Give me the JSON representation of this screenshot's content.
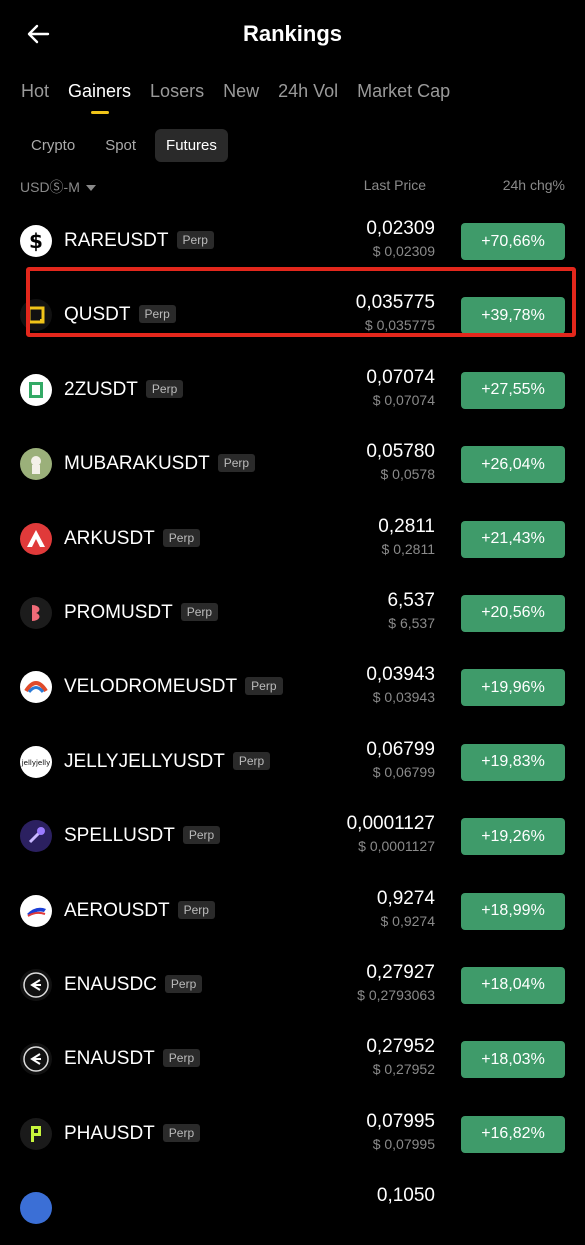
{
  "header": {
    "title": "Rankings"
  },
  "tabs": [
    "Hot",
    "Gainers",
    "Losers",
    "New",
    "24h Vol",
    "Market Cap"
  ],
  "active_tab": 1,
  "subtabs": [
    "Crypto",
    "Spot",
    "Futures"
  ],
  "active_subtab": 2,
  "columns": {
    "market": "USDⓈ-M",
    "last_price": "Last Price",
    "change": "24h chg%"
  },
  "colors": {
    "gain": "#3f9b6a",
    "accent": "#f0c419",
    "highlight": "#e3271c"
  },
  "rows": [
    {
      "symbol": "RAREUSDT",
      "tag": "Perp",
      "price": "0,02309",
      "usd": "$ 0,02309",
      "change": "+70,66%",
      "icon": "rare-icon"
    },
    {
      "symbol": "QUSDT",
      "tag": "Perp",
      "price": "0,035775",
      "usd": "$ 0,035775",
      "change": "+39,78%",
      "icon": "q-icon"
    },
    {
      "symbol": "2ZUSDT",
      "tag": "Perp",
      "price": "0,07074",
      "usd": "$ 0,07074",
      "change": "+27,55%",
      "icon": "2z-icon"
    },
    {
      "symbol": "MUBARAKUSDT",
      "tag": "Perp",
      "price": "0,05780",
      "usd": "$ 0,0578",
      "change": "+26,04%",
      "icon": "mubarak-icon"
    },
    {
      "symbol": "ARKUSDT",
      "tag": "Perp",
      "price": "0,2811",
      "usd": "$ 0,2811",
      "change": "+21,43%",
      "icon": "ark-icon"
    },
    {
      "symbol": "PROMUSDT",
      "tag": "Perp",
      "price": "6,537",
      "usd": "$ 6,537",
      "change": "+20,56%",
      "icon": "prom-icon"
    },
    {
      "symbol": "VELODROMEUSDT",
      "tag": "Perp",
      "price": "0,03943",
      "usd": "$ 0,03943",
      "change": "+19,96%",
      "icon": "velodrome-icon"
    },
    {
      "symbol": "JELLYJELLYUSDT",
      "tag": "Perp",
      "price": "0,06799",
      "usd": "$ 0,06799",
      "change": "+19,83%",
      "icon": "jellyjelly-icon"
    },
    {
      "symbol": "SPELLUSDT",
      "tag": "Perp",
      "price": "0,0001127",
      "usd": "$ 0,0001127",
      "change": "+19,26%",
      "icon": "spell-icon"
    },
    {
      "symbol": "AEROUSDT",
      "tag": "Perp",
      "price": "0,9274",
      "usd": "$ 0,9274",
      "change": "+18,99%",
      "icon": "aero-icon"
    },
    {
      "symbol": "ENAUSDC",
      "tag": "Perp",
      "price": "0,27927",
      "usd": "$ 0,2793063",
      "change": "+18,04%",
      "icon": "ena-icon"
    },
    {
      "symbol": "ENAUSDT",
      "tag": "Perp",
      "price": "0,27952",
      "usd": "$ 0,27952",
      "change": "+18,03%",
      "icon": "ena-icon"
    },
    {
      "symbol": "PHAUSDT",
      "tag": "Perp",
      "price": "0,07995",
      "usd": "$ 0,07995",
      "change": "+16,82%",
      "icon": "pha-icon"
    },
    {
      "symbol": "",
      "tag": "",
      "price": "0,1050",
      "usd": "",
      "change": "",
      "icon": "partial-icon"
    }
  ]
}
